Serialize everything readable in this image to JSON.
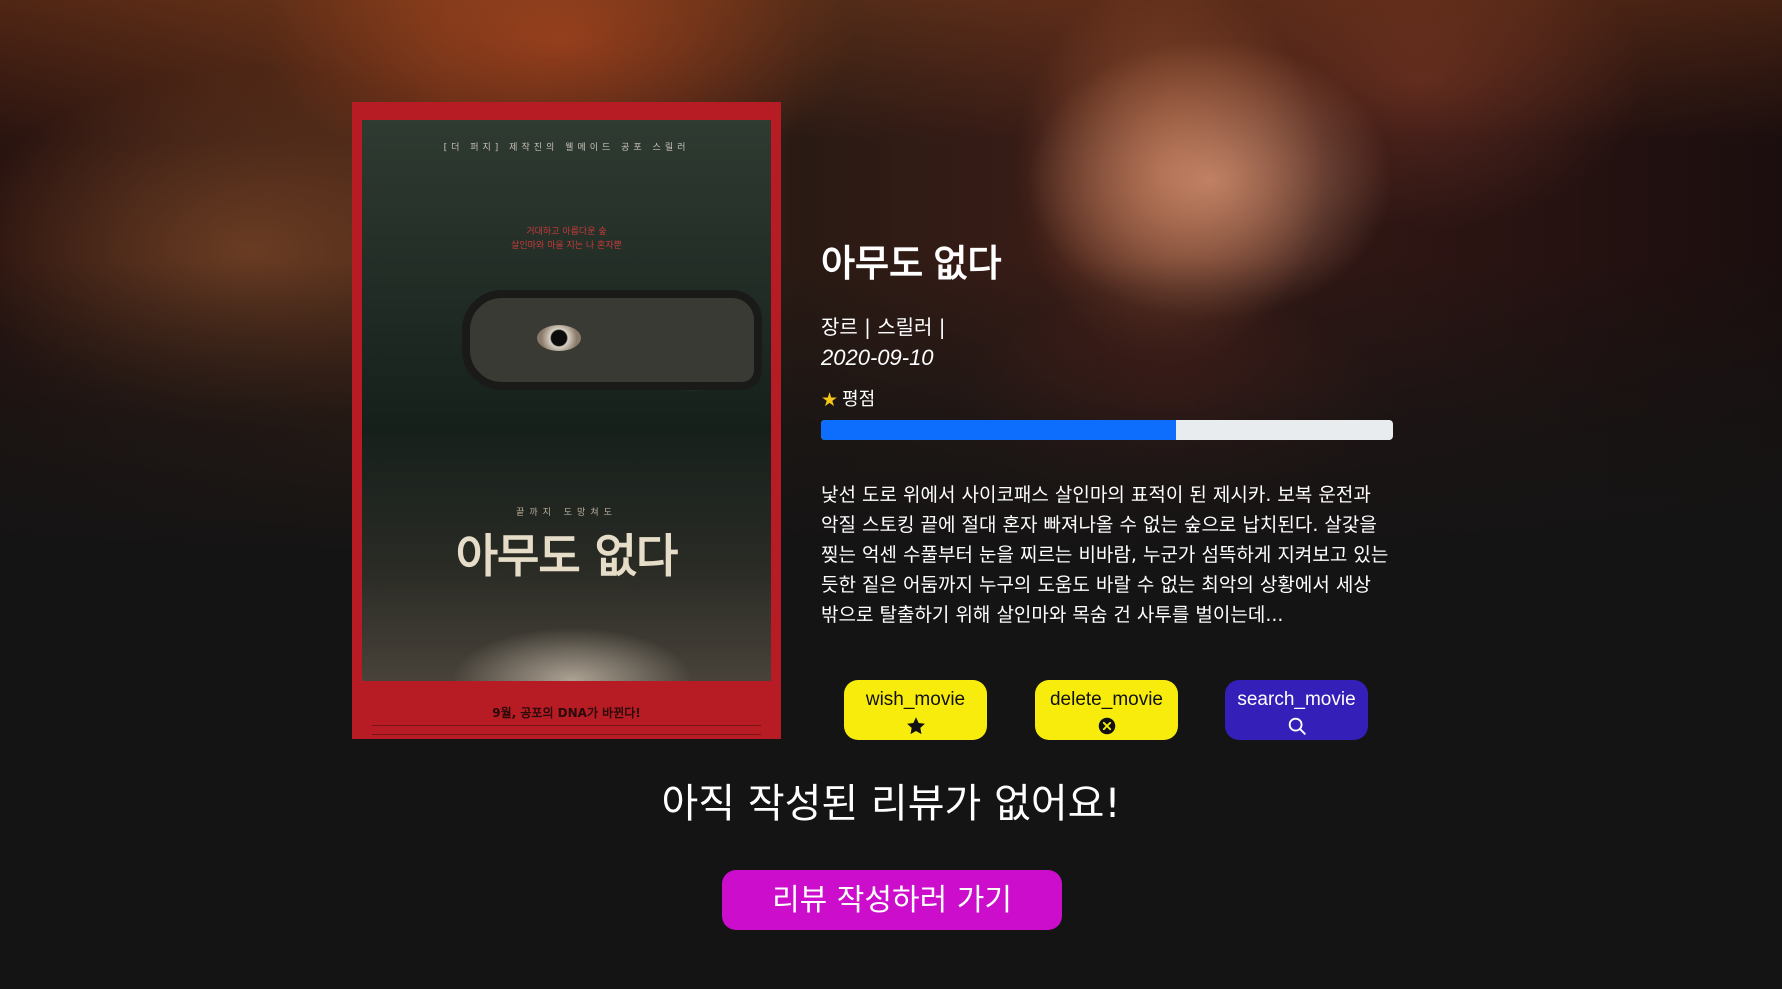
{
  "movie": {
    "title": "아무도 없다",
    "genre_line": "장르 | 스릴러 |",
    "release_date": "2020-09-10",
    "rating_label": "평점",
    "rating_fraction": 0.62,
    "overview": "낯선 도로 위에서 사이코패스 살인마의 표적이 된 제시카. 보복 운전과 악질 스토킹 끝에 절대 혼자 빠져나올 수 없는 숲으로 납치된다. 살갗을 찢는 억센 수풀부터 눈을 찌르는 비바람, 누군가 섬뜩하게 지켜보고 있는 듯한 짙은 어둠까지 누구의 도움도 바랄 수 없는 최악의 상황에서 세상 밖으로 탈출하기 위해 살인마와 목숨 건 사투를 벌이는데..."
  },
  "poster": {
    "top_line": "[더 퍼지] 제작진의 웰메이드 공포 스릴러",
    "tagline_1": "거대하고 아름다운 숲",
    "tagline_2": "살인마와 마을 지는 나 혼자뿐",
    "subtitle": "끝까지 도망쳐도",
    "title": "아무도 없다",
    "bottom_line": "9월, 공포의 DNA가 바뀐다!"
  },
  "actions": {
    "wish_label": "wish_movie",
    "delete_label": "delete_movie",
    "search_label": "search_movie",
    "wish_icon": "star-icon",
    "delete_icon": "x-circle-icon",
    "search_icon": "search-icon"
  },
  "reviews": {
    "empty_message": "아직 작성된 리뷰가 없어요!",
    "write_button": "리뷰 작성하러 가기"
  },
  "colors": {
    "progress_fill": "#0d6efd",
    "wish_button": "#f7ec0b",
    "delete_button": "#f7ec0b",
    "search_button": "#3420b8",
    "write_button": "#cc0dcc",
    "poster_frame": "#b71c24",
    "rating_star": "#f5c518"
  }
}
